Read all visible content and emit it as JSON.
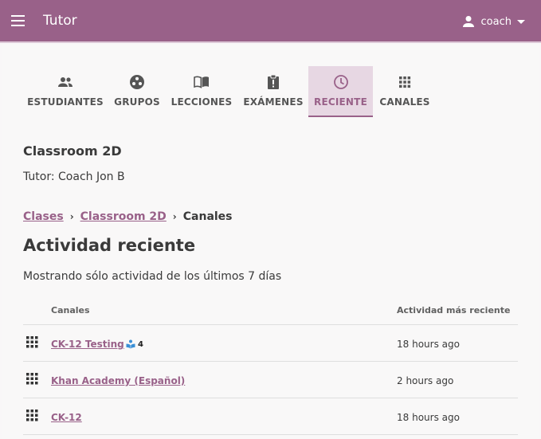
{
  "appbar": {
    "title": "Tutor",
    "user_name": "coach"
  },
  "tabs": [
    {
      "label": "ESTUDIANTES",
      "icon": "people-icon"
    },
    {
      "label": "GRUPOS",
      "icon": "groups-icon"
    },
    {
      "label": "LECCIONES",
      "icon": "book-icon"
    },
    {
      "label": "EXÁMENES",
      "icon": "exam-icon"
    },
    {
      "label": "RECIENTE",
      "icon": "clock-icon",
      "active": true
    },
    {
      "label": "CANALES",
      "icon": "grid-icon"
    }
  ],
  "classroom": {
    "name": "Classroom 2D",
    "coach_line": "Tutor: Coach Jon B"
  },
  "breadcrumb": {
    "root": "Clases",
    "classroom": "Classroom 2D",
    "current": "Canales"
  },
  "main": {
    "title": "Actividad reciente",
    "subtitle": "Mostrando sólo actividad de los últimos 7 días"
  },
  "table": {
    "headers": [
      "Canales",
      "Actividad más reciente"
    ],
    "rows": [
      {
        "channel": "CK-12 Testing",
        "badge_count": "4",
        "badge_icon": "lesson-icon",
        "activity": "18 hours ago"
      },
      {
        "channel": "Khan Academy (Español)",
        "activity": "2 hours ago"
      },
      {
        "channel": "CK-12",
        "activity": "18 hours ago"
      }
    ]
  },
  "colors": {
    "brand": "#996189",
    "active_tab_bg": "#e7d7e3",
    "badge_icon": "#3a8fd6"
  }
}
